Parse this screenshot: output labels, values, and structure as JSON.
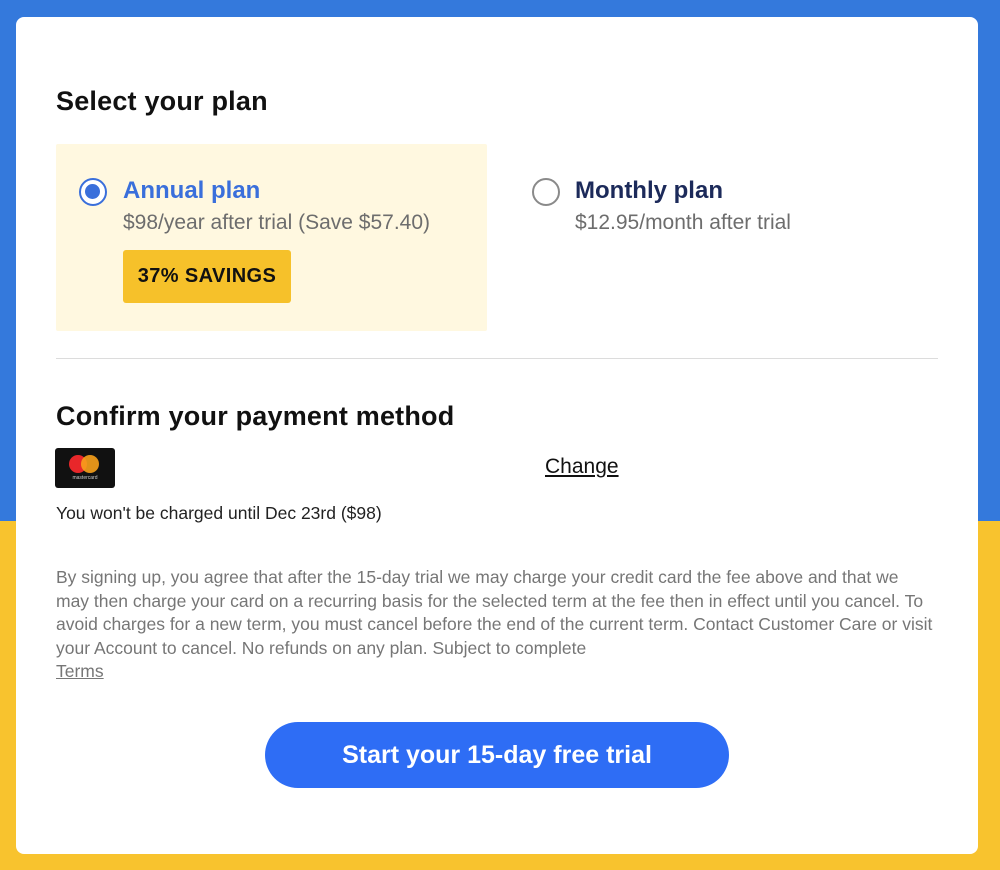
{
  "colors": {
    "background_top": "#3479dc",
    "background_bottom": "#f8c32e",
    "selected_plan_bg": "#fff8e0",
    "accent_blue": "#3a6fdb",
    "plan_title_dark": "#1c2a5a",
    "badge_yellow": "#f6c12a",
    "cta_blue": "#2e6df5"
  },
  "plan_section": {
    "heading": "Select your plan",
    "plans": [
      {
        "title": "Annual plan",
        "subtitle": "$98/year after trial (Save $57.40)",
        "badge": "37% SAVINGS",
        "selected": true
      },
      {
        "title": "Monthly plan",
        "subtitle": "$12.95/month after trial",
        "selected": false
      }
    ]
  },
  "payment_section": {
    "heading": "Confirm your payment method",
    "card_icon": "mastercard-icon",
    "card_icon_text": "mastercard",
    "change_label": "Change",
    "charge_note": "You won't be charged until Dec 23rd ($98)"
  },
  "legal": {
    "text": "By signing up, you agree that after the 15-day trial we may charge your credit card the fee above and that we may then charge your card on a recurring basis for the selected term at the fee then in effect until you cancel. To avoid charges for a new term, you must cancel before the end of the current term. Contact Customer Care or visit your Account to cancel. No refunds on any plan. Subject to complete",
    "link_label": "Terms"
  },
  "cta": {
    "label": "Start your 15-day free trial"
  }
}
